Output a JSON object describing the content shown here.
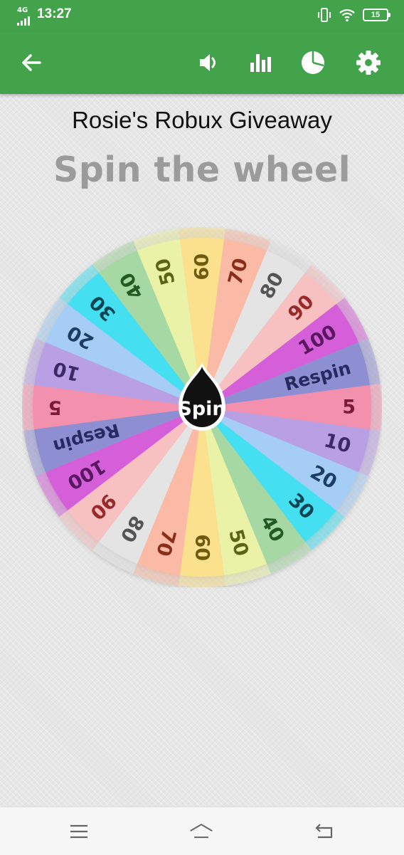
{
  "status_bar": {
    "network": "4G",
    "time": "13:27",
    "battery": "15",
    "icons": [
      "signal-icon",
      "vibrate-icon",
      "wifi-icon",
      "battery-icon"
    ]
  },
  "app_bar": {
    "icons": [
      "back-arrow-icon",
      "volume-icon",
      "stats-icon",
      "pie-chart-icon",
      "settings-gear-icon"
    ],
    "color": "#43a34a"
  },
  "title": "Rosie's Robux Giveaway",
  "subtitle": "Spin the wheel",
  "wheel": {
    "center_label": "Spin",
    "segments": [
      {
        "label": "60",
        "color": "#fbe08d",
        "text": "#6d5a10"
      },
      {
        "label": "70",
        "color": "#fbbaa5",
        "text": "#8a2f1a"
      },
      {
        "label": "80",
        "color": "#e4e4e4",
        "text": "#555555"
      },
      {
        "label": "90",
        "color": "#f8c1c1",
        "text": "#9a2b2b"
      },
      {
        "label": "100",
        "color": "#d45ed8",
        "text": "#5a1560"
      },
      {
        "label": "Respin",
        "color": "#8e8fd2",
        "text": "#262c60"
      },
      {
        "label": "5",
        "color": "#f390ad",
        "text": "#7a1f36"
      },
      {
        "label": "10",
        "color": "#b9a0e4",
        "text": "#3b2a66"
      },
      {
        "label": "20",
        "color": "#a5cdf5",
        "text": "#1c3d66"
      },
      {
        "label": "30",
        "color": "#45dff2",
        "text": "#0d4552"
      },
      {
        "label": "40",
        "color": "#a5d8a2",
        "text": "#245a24"
      },
      {
        "label": "50",
        "color": "#e9f2a6",
        "text": "#5b6414"
      },
      {
        "label": "60",
        "color": "#fbe08d",
        "text": "#6d5a10"
      },
      {
        "label": "70",
        "color": "#fbbaa5",
        "text": "#8a2f1a"
      },
      {
        "label": "80",
        "color": "#e4e4e4",
        "text": "#555555"
      },
      {
        "label": "90",
        "color": "#f8c1c1",
        "text": "#9a2b2b"
      },
      {
        "label": "100",
        "color": "#d45ed8",
        "text": "#5a1560"
      },
      {
        "label": "Respin",
        "color": "#8e8fd2",
        "text": "#262c60"
      },
      {
        "label": "5",
        "color": "#f390ad",
        "text": "#7a1f36"
      },
      {
        "label": "10",
        "color": "#b9a0e4",
        "text": "#3b2a66"
      },
      {
        "label": "20",
        "color": "#a5cdf5",
        "text": "#1c3d66"
      },
      {
        "label": "30",
        "color": "#45dff2",
        "text": "#0d4552"
      },
      {
        "label": "40",
        "color": "#a5d8a2",
        "text": "#245a24"
      },
      {
        "label": "50",
        "color": "#e9f2a6",
        "text": "#5b6414"
      }
    ]
  },
  "nav_bar": {
    "icons": [
      "menu-icon",
      "home-icon",
      "back-icon"
    ]
  }
}
